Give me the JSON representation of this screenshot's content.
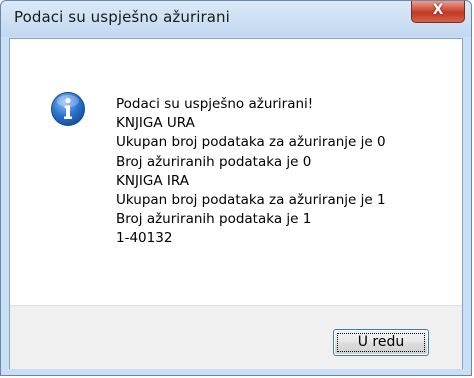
{
  "window": {
    "title": "Podaci su uspješno ažurirani",
    "close_glyph": "X"
  },
  "dialog": {
    "icon": "info-icon",
    "message_lines": [
      "Podaci su uspješno ažurirani!",
      "KNJIGA URA",
      "Ukupan broj podataka za ažuriranje je 0",
      "Broj ažuriranih podataka je 0",
      "KNJIGA IRA",
      "Ukupan broj podataka za ažuriranje je 1",
      "Broj ažuriranih podataka je 1",
      "1-40132"
    ],
    "ok_label": "U redu"
  },
  "colors": {
    "titlebar": "#c9dff5",
    "close_button": "#c8402b",
    "ok_button_border": "#3c7fb1",
    "icon_blue": "#1f5fb5"
  }
}
